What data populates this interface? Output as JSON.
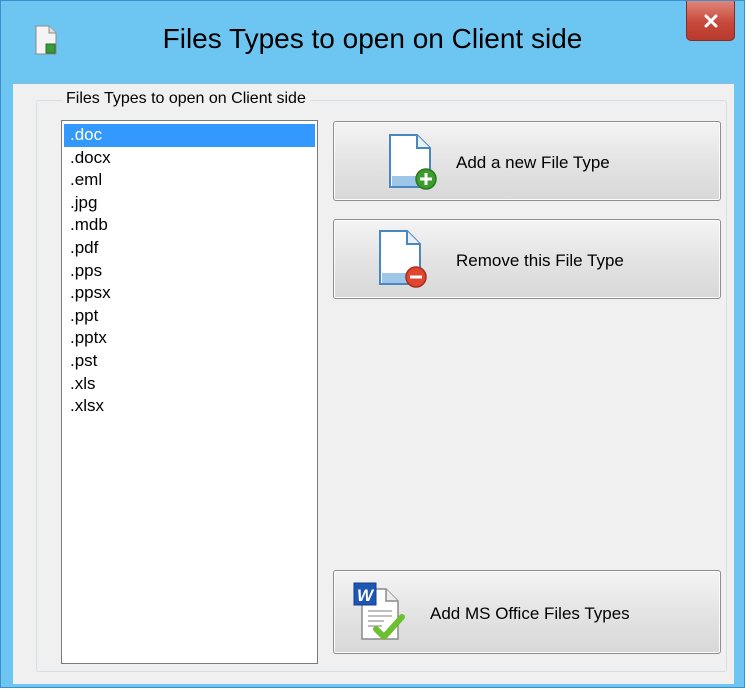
{
  "window": {
    "title": "Files Types to open on Client side"
  },
  "group": {
    "label": "Files Types to open on Client side"
  },
  "list": {
    "items": [
      ".doc",
      ".docx",
      ".eml",
      ".jpg",
      ".mdb",
      ".pdf",
      ".pps",
      ".ppsx",
      ".ppt",
      ".pptx",
      ".pst",
      ".xls",
      ".xlsx"
    ],
    "selected": ".doc"
  },
  "buttons": {
    "add": "Add a new File Type",
    "remove": "Remove this File Type",
    "add_office": "Add MS Office Files Types"
  },
  "colors": {
    "frame": "#6dc6f1",
    "selection": "#3399ff",
    "close": "#c7493b"
  }
}
